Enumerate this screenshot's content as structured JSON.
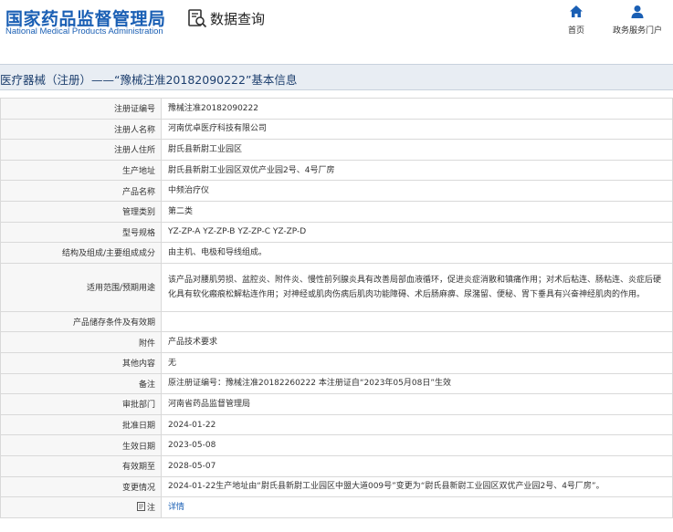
{
  "header": {
    "logo_cn": "国家药品监督管理局",
    "logo_en": "National Medical Products Administration",
    "search_title": "数据查询",
    "nav": [
      {
        "label": "首页",
        "icon": "home-icon"
      },
      {
        "label": "政务服务门户",
        "icon": "user-icon"
      }
    ]
  },
  "title": "医疗器械（注册）——“豫械注准20182090222”基本信息",
  "rows": [
    {
      "label": "注册证编号",
      "value": "豫械注准20182090222"
    },
    {
      "label": "注册人名称",
      "value": "河南优卓医疗科技有限公司"
    },
    {
      "label": "注册人住所",
      "value": "尉氏县新尉工业园区"
    },
    {
      "label": "生产地址",
      "value": "尉氏县新尉工业园区双优产业园2号、4号厂房"
    },
    {
      "label": "产品名称",
      "value": "中频治疗仪"
    },
    {
      "label": "管理类别",
      "value": "第二类"
    },
    {
      "label": "型号规格",
      "value": "YZ-ZP-A YZ-ZP-B YZ-ZP-C YZ-ZP-D"
    },
    {
      "label": "结构及组成/主要组成成分",
      "value": "由主机、电极和导线组成。"
    },
    {
      "label": "适用范围/预期用途",
      "value": "该产品对腰肌劳损、盆腔炎、附件炎、慢性前列腺炎具有改善局部血液循环，促进炎症消散和镇痛作用；对术后粘连、肠粘连、炎症后硬化具有软化瘢痕松解粘连作用；对神经或肌肉伤病后肌肉功能障碍、术后肠麻痹、尿潴留、便秘、胃下垂具有兴奋神经肌肉的作用。"
    },
    {
      "label": "产品储存条件及有效期",
      "value": ""
    },
    {
      "label": "附件",
      "value": "产品技术要求"
    },
    {
      "label": "其他内容",
      "value": "无"
    },
    {
      "label": "备注",
      "value": "原注册证编号：豫械注准20182260222 本注册证自“2023年05月08日”生效"
    },
    {
      "label": "审批部门",
      "value": "河南省药品监督管理局"
    },
    {
      "label": "批准日期",
      "value": "2024-01-22"
    },
    {
      "label": "生效日期",
      "value": "2023-05-08"
    },
    {
      "label": "有效期至",
      "value": "2028-05-07"
    },
    {
      "label": "变更情况",
      "value": "2024-01-22生产地址由“尉氏县新尉工业园区中盟大道009号”变更为“尉氏县新尉工业园区双优产业园2号、4号厂房”。"
    },
    {
      "label": "注",
      "value": "详情",
      "icon": "note-icon"
    }
  ]
}
